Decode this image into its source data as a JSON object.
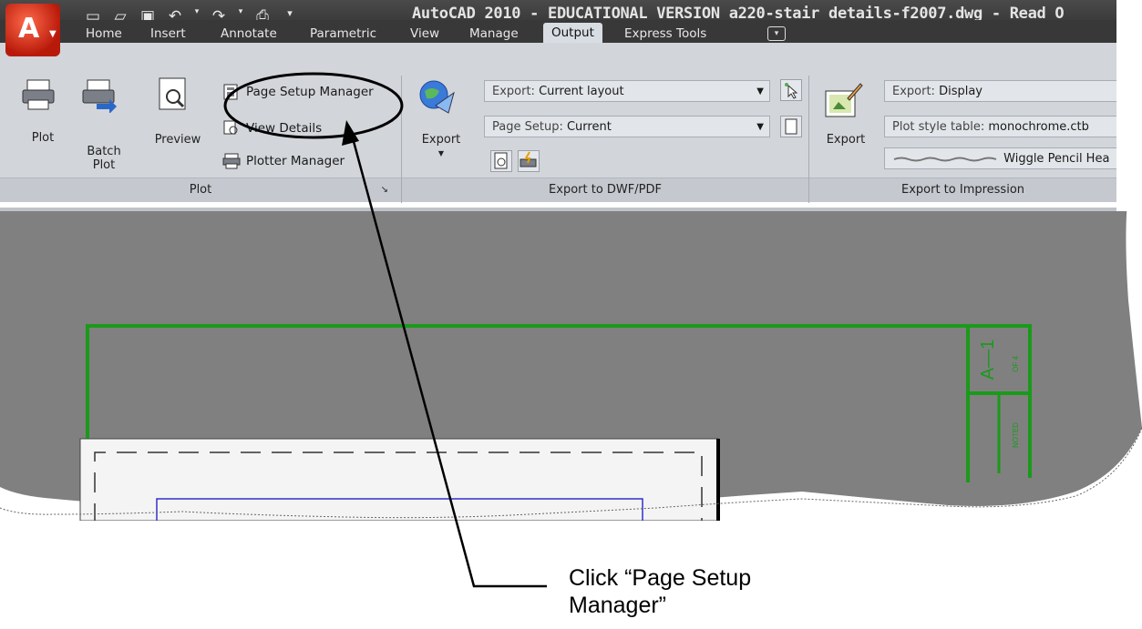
{
  "window": {
    "title": "AutoCAD 2010 - EDUCATIONAL VERSION    a220-stair details-f2007.dwg - Read O"
  },
  "app_menu": {
    "logo": "A",
    "icon": "autocad-logo-icon"
  },
  "quick_access": {
    "icons": [
      "new-icon",
      "open-icon",
      "save-icon",
      "undo-icon",
      "redo-icon",
      "plot-icon",
      "customize-icon"
    ]
  },
  "menu": {
    "tabs": [
      "Home",
      "Insert",
      "Annotate",
      "Parametric",
      "View",
      "Manage",
      "Output",
      "Express Tools"
    ],
    "active_tab": "Output"
  },
  "ribbon": {
    "plot_panel": {
      "plot_label": "Plot",
      "batch_plot_label": "Batch\nPlot",
      "preview_label": "Preview",
      "page_setup_manager_label": "Page Setup Manager",
      "view_details_label": "View Details",
      "plotter_manager_label": "Plotter Manager",
      "footer": "Plot"
    },
    "export_panel": {
      "export_label": "Export",
      "export_combo_label": "Export:",
      "export_combo_value": "Current layout",
      "page_setup_combo_label": "Page Setup:",
      "page_setup_combo_value": "Current",
      "footer": "Export to DWF/PDF"
    },
    "impression_panel": {
      "export_label": "Export",
      "export_display_label": "Export:",
      "export_display_value": "Display",
      "plot_style_label": "Plot style table:",
      "plot_style_value": "monochrome.ctb",
      "pencil_value": "Wiggle Pencil Hea",
      "footer": "Export to Impression"
    }
  },
  "drawing": {
    "sheet_number": "A—1",
    "sheet_of": "OF 4",
    "scale_note": "NOTED"
  },
  "annotation": {
    "line1": "Click “Page Setup",
    "line2": "Manager”"
  },
  "colors": {
    "title_bar": "#333333",
    "ribbon_bg": "#d2d5da",
    "canvas_bg": "#808080",
    "border_green": "#1a9a1a",
    "viewport_blue": "#3030cc"
  }
}
